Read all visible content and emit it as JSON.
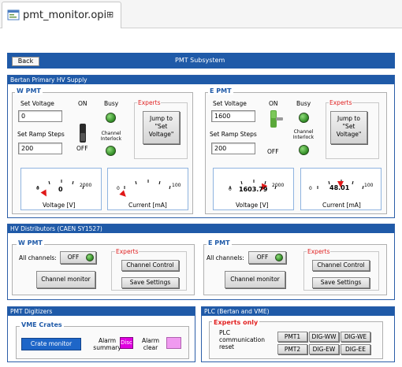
{
  "tab": {
    "title": "pmt_monitor.opi",
    "close_glyph": "⊞"
  },
  "topbar": {
    "back_label": "Back",
    "title": "PMT Subsystem"
  },
  "hv_supply": {
    "header": "Bertan Primary HV Supply",
    "w": {
      "title": "W PMT",
      "set_voltage_label": "Set Voltage",
      "set_voltage_value": "0",
      "set_ramp_label": "Set Ramp Steps",
      "set_ramp_value": "200",
      "on_label": "ON",
      "off_label": "OFF",
      "busy_label": "Busy",
      "interlock_label": "Channel Interlock",
      "experts_label": "Experts",
      "jump_label": "Jump to \"Set Voltage\"",
      "voltage_meter": {
        "value": "0",
        "min": "0",
        "max": "2000",
        "label": "Voltage [V]",
        "level": 0
      },
      "current_meter": {
        "value": "",
        "min": "0",
        "max": "100",
        "label": "Current [mA]",
        "level": 0
      }
    },
    "e": {
      "title": "E PMT",
      "set_voltage_label": "Set Voltage",
      "set_voltage_value": "1600",
      "set_ramp_label": "Set Ramp Steps",
      "set_ramp_value": "200",
      "on_label": "ON",
      "off_label": "OFF",
      "busy_label": "Busy",
      "interlock_label": "Channel Interlock",
      "experts_label": "Experts",
      "jump_label": "Jump to \"Set Voltage\"",
      "voltage_meter": {
        "value": "1603.79",
        "min": "0",
        "max": "2000",
        "label": "Voltage [V]",
        "level": 0.8
      },
      "current_meter": {
        "value": "48.01",
        "min": "0",
        "max": "100",
        "label": "Current [mA]",
        "level": 0.48
      }
    }
  },
  "hv_distributors": {
    "header": "HV Distributors (CAEN SY1527)",
    "w": {
      "title": "W PMT",
      "all_channels_label": "All channels:",
      "off_label": "OFF",
      "channel_monitor_label": "Channel monitor",
      "experts_label": "Experts",
      "channel_control_label": "Channel Control",
      "save_settings_label": "Save Settings"
    },
    "e": {
      "title": "E PMT",
      "all_channels_label": "All channels:",
      "off_label": "OFF",
      "channel_monitor_label": "Channel monitor",
      "experts_label": "Experts",
      "channel_control_label": "Channel Control",
      "save_settings_label": "Save Settings"
    }
  },
  "digitizers": {
    "header": "PMT Digitizers",
    "group_title": "VME Crates",
    "crate_monitor_label": "Crate monitor",
    "alarm_summary_label": "Alarm summary",
    "alarm_summary_badge": "Disc",
    "alarm_clear_label": "Alarm clear"
  },
  "plc": {
    "header": "PLC (Bertan and VME)",
    "experts_label": "Experts only",
    "comm_reset_label": "PLC communication reset",
    "buttons": [
      "PMT1",
      "DIG-WW",
      "DIG-WE",
      "PMT2",
      "DIG-EW",
      "DIG-EE"
    ]
  },
  "colors": {
    "header_blue": "#1f5aa8",
    "led_green": "#3a9a2a",
    "experts_red": "#e02020",
    "alarm_magenta": "#e000e0"
  }
}
